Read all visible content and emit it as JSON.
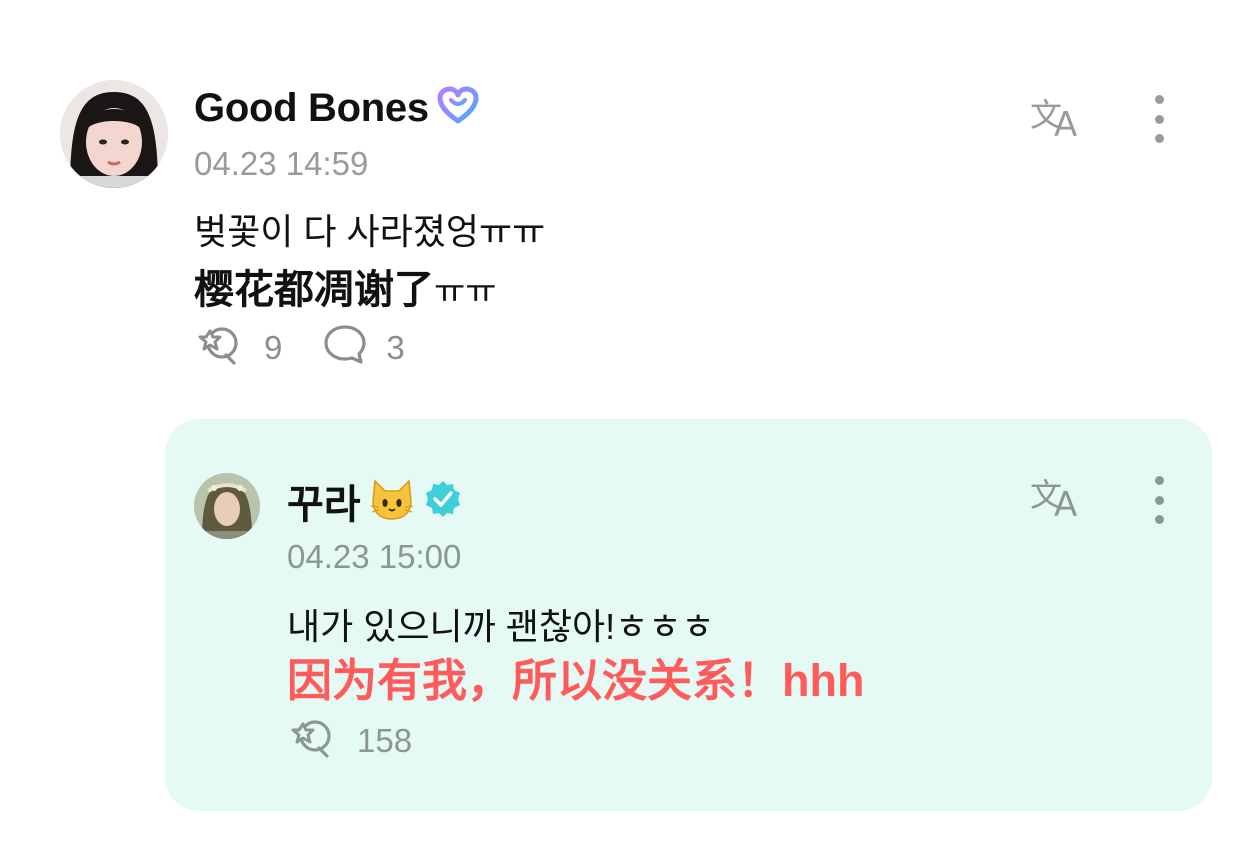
{
  "post": {
    "author": "Good Bones",
    "timestamp": "04.23 14:59",
    "text_ko": "벚꽃이 다 사라졌엉ㅠㅠ",
    "text_zh": "樱花都凋谢了",
    "text_zh_suffix": "ㅠㅠ",
    "likes": "9",
    "comments": "3",
    "badge_icon": "membership-heart-icon"
  },
  "reply": {
    "author": "꾸라",
    "author_emoji": "🐱",
    "timestamp": "04.23 15:00",
    "text_ko": "내가 있으니까 괜찮아!ㅎㅎㅎ",
    "text_zh": "因为有我，所以没关系！hhh",
    "text_zh_color": "#ff5b5b",
    "likes": "158",
    "background_color": "#e5f9f5",
    "badge_icon": "verified-badge-icon"
  },
  "colors": {
    "badge_gradient_start": "#6b7bff",
    "badge_gradient_end": "#b77cff",
    "verified": "#3ed0d8",
    "muted": "#9a9a9a"
  }
}
